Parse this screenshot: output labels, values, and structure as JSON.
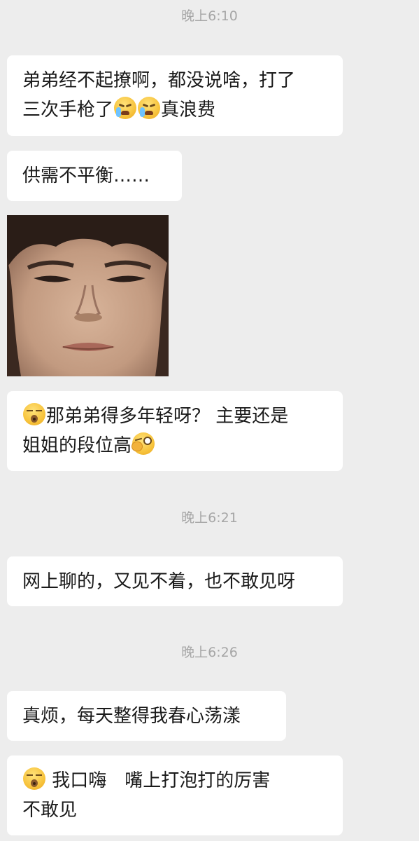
{
  "timestamps": {
    "t1": "晚上6:10",
    "t2": "晚上6:21",
    "t3": "晚上6:26"
  },
  "messages": {
    "m1": {
      "line1": "弟弟经不起撩啊，都没说啥，打了",
      "line2_pre": "三次手枪了",
      "line2_post": "真浪费",
      "emojis": [
        "loudly-crying-face-emoji",
        "loudly-crying-face-emoji"
      ]
    },
    "m2": {
      "text": "供需不平衡……"
    },
    "m3": {
      "type": "image",
      "description": "sticker photo"
    },
    "m4": {
      "line1": "那弟弟得多年轻呀？ 主要还是",
      "line2": "姐姐的段位高",
      "emojis": [
        "humming-face-emoji",
        "wink-face-emoji"
      ]
    },
    "m5": {
      "text": "网上聊的，又见不着，也不敢见呀"
    },
    "m6": {
      "text": "真烦，每天整得我春心荡漾"
    },
    "m7": {
      "line1": " 我口嗨　嘴上打泡打的厉害",
      "line2": "不敢见",
      "emojis": [
        "humming-face-emoji"
      ]
    }
  },
  "colors": {
    "background": "#ededed",
    "bubble": "#ffffff",
    "text": "#1a1a1a",
    "timestamp": "#a6a6a6"
  }
}
